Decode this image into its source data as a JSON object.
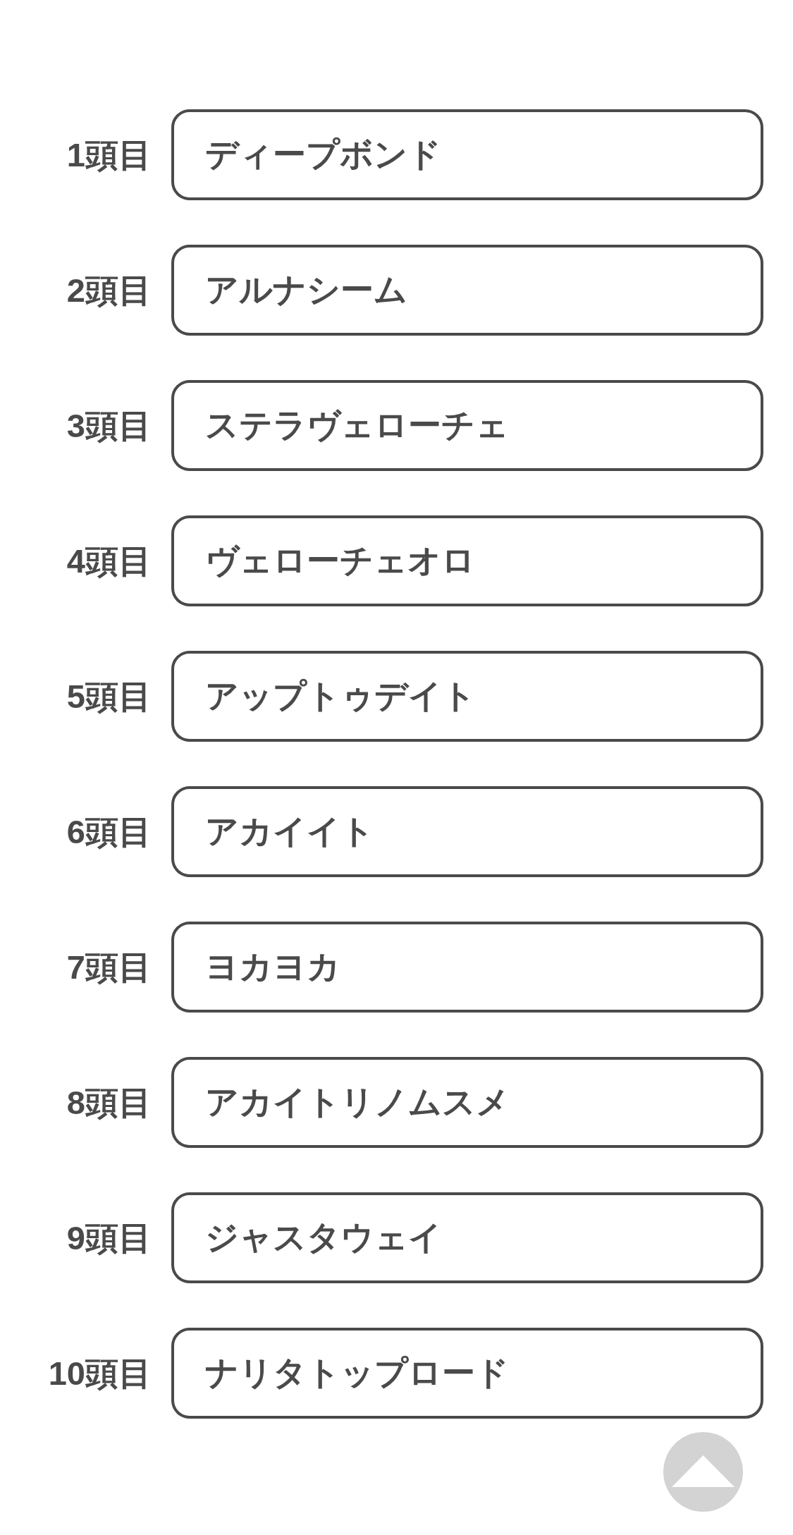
{
  "horses": [
    {
      "label": "1頭目",
      "value": "ディープボンド"
    },
    {
      "label": "2頭目",
      "value": "アルナシーム"
    },
    {
      "label": "3頭目",
      "value": "ステラヴェローチェ"
    },
    {
      "label": "4頭目",
      "value": "ヴェローチェオロ"
    },
    {
      "label": "5頭目",
      "value": "アップトゥデイト"
    },
    {
      "label": "6頭目",
      "value": "アカイイト"
    },
    {
      "label": "7頭目",
      "value": "ヨカヨカ"
    },
    {
      "label": "8頭目",
      "value": "アカイトリノムスメ"
    },
    {
      "label": "9頭目",
      "value": "ジャスタウェイ"
    },
    {
      "label": "10頭目",
      "value": "ナリタトップロード"
    }
  ]
}
